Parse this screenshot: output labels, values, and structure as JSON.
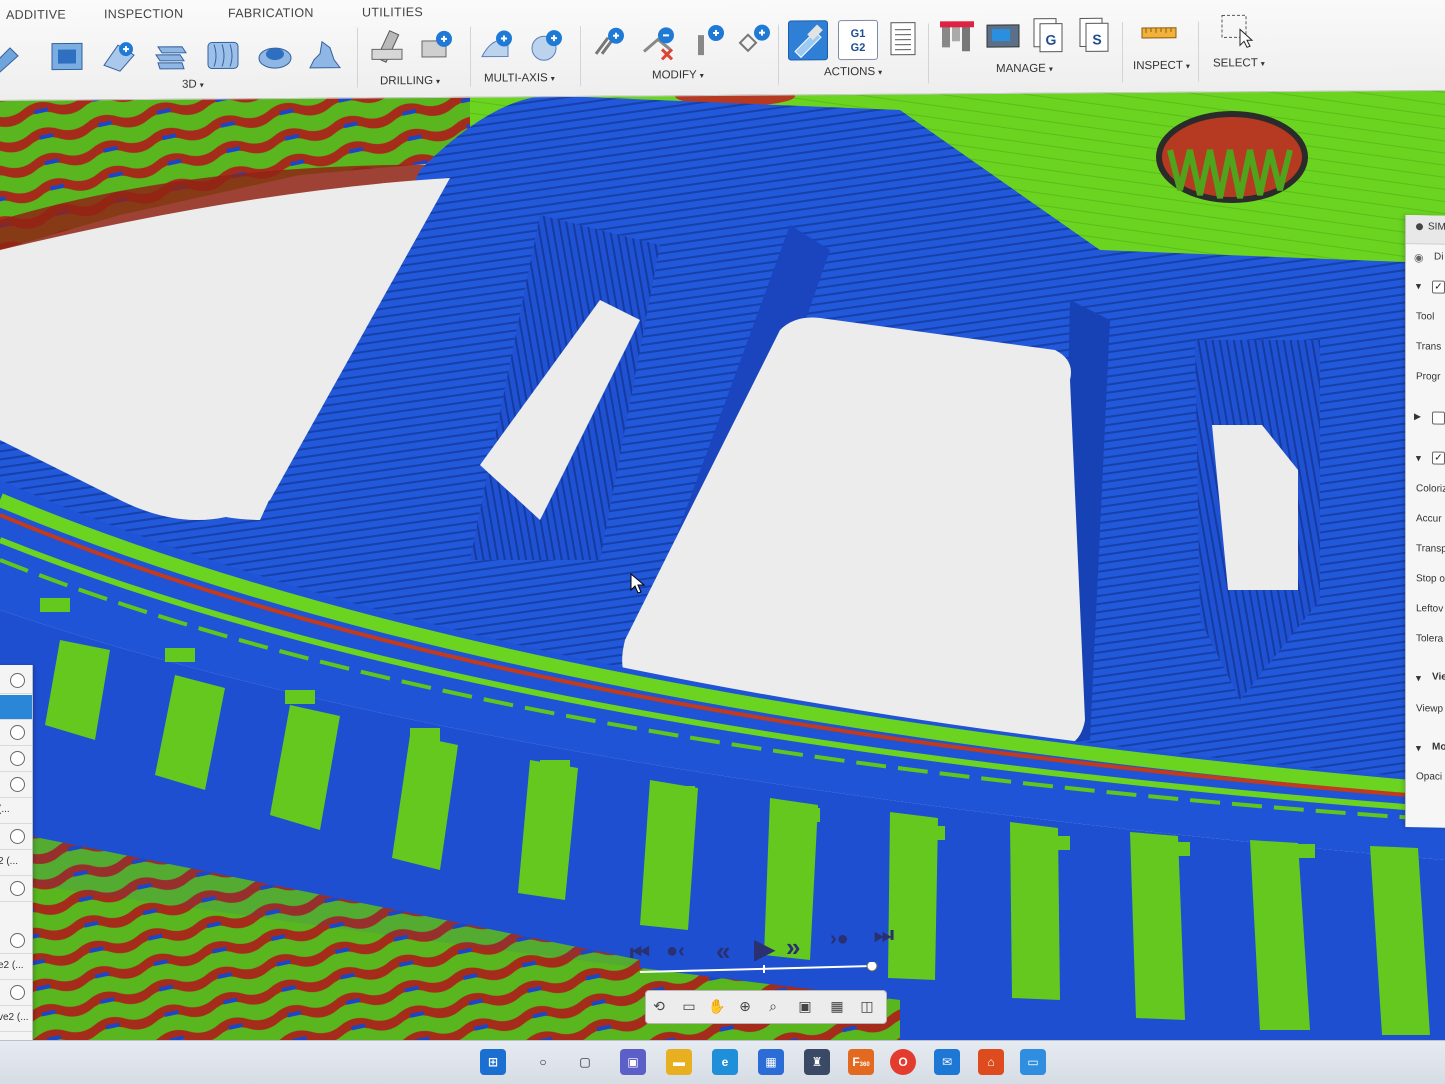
{
  "ribbon": {
    "tabs": [
      "ADDITIVE",
      "INSPECTION",
      "FABRICATION",
      "UTILITIES"
    ],
    "groups": [
      {
        "label": "3D",
        "has_menu": true
      },
      {
        "label": "DRILLING",
        "has_menu": true
      },
      {
        "label": "MULTI-AXIS",
        "has_menu": true
      },
      {
        "label": "MODIFY",
        "has_menu": true
      },
      {
        "label": "ACTIONS",
        "has_menu": true
      },
      {
        "label": "MANAGE",
        "has_menu": true
      },
      {
        "label": "INSPECT",
        "has_menu": true
      },
      {
        "label": "SELECT",
        "has_menu": true
      }
    ],
    "g1g2_text": [
      "G1",
      "G2"
    ],
    "caret": "▾"
  },
  "sim_panel": {
    "title": "SIM",
    "rows": [
      "Di",
      "Tool",
      "Trans",
      "Progr",
      "Coloriz",
      "Accur",
      "Transp",
      "Stop o",
      "Leftov",
      "Tolera",
      "Vie",
      "Viewp",
      "Mo",
      "Opaci"
    ]
  },
  "left_panel": {
    "labels": [
      "(...",
      "2 (...",
      "e2 (...",
      "ve2 (..."
    ]
  },
  "playback": {
    "first": "⏮",
    "prev_event": "●‹",
    "step_back": "«",
    "play": "▶",
    "step_forward": "»",
    "next_event": "›●",
    "last": "⏭",
    "timeline_position": 1.0
  },
  "taskbar": {
    "fusion_badge": "F",
    "fusion_sub": "360"
  },
  "colors": {
    "stock_blue": "#1f57d8",
    "stock_blue_dark": "#173fae",
    "gouge_green": "#66d41f",
    "excess_red": "#b8321c",
    "background": "#ececec",
    "selection_blue": "#2a86d6"
  }
}
